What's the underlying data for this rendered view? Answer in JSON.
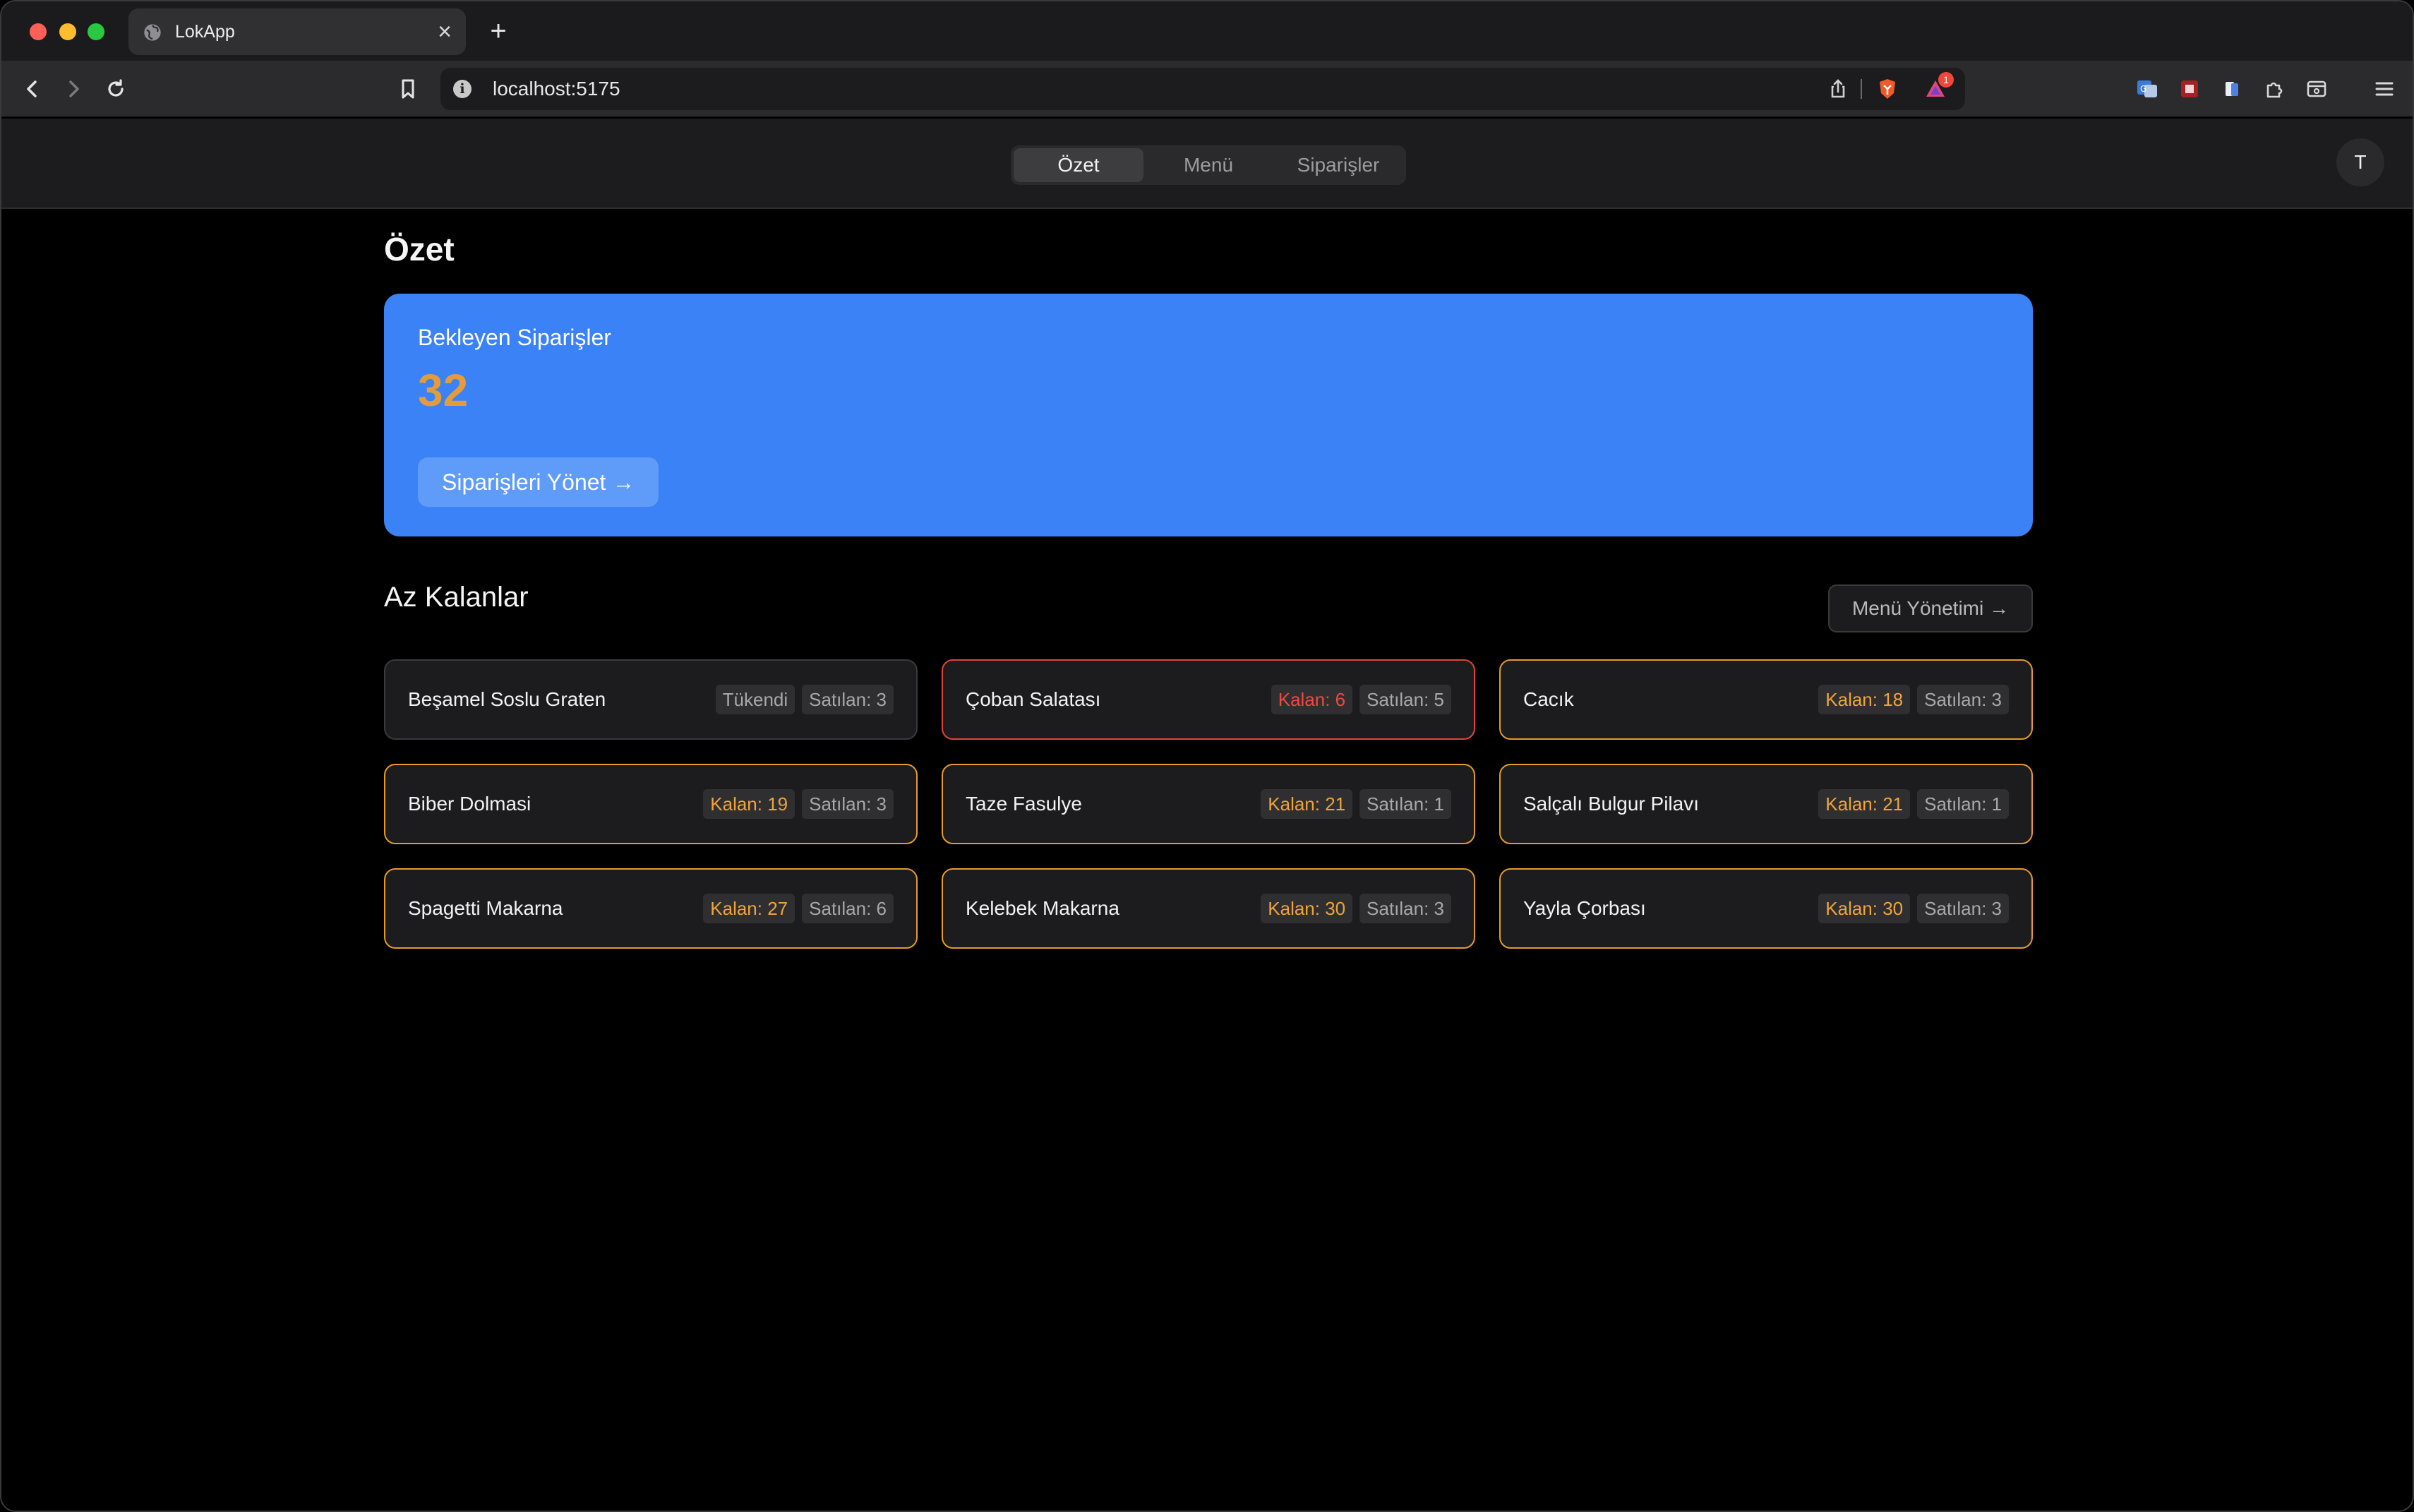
{
  "browser": {
    "tab_title": "LokApp",
    "url": "localhost:5175",
    "extension_badge": "1"
  },
  "nav": {
    "tabs": [
      {
        "label": "Özet",
        "active": true
      },
      {
        "label": "Menü",
        "active": false
      },
      {
        "label": "Siparişler",
        "active": false
      }
    ],
    "avatar_initial": "T"
  },
  "page": {
    "title": "Özet"
  },
  "pending": {
    "label": "Bekleyen Siparişler",
    "count": "32",
    "button": "Siparişleri Yönet →"
  },
  "low_stock": {
    "title": "Az Kalanlar",
    "button": "Menü Yönetimi →",
    "items": [
      {
        "name": "Beşamel Soslu Graten",
        "stock": "Tükendi",
        "sold": "Satılan: 3",
        "level": "out"
      },
      {
        "name": "Çoban Salatası",
        "stock": "Kalan: 6",
        "sold": "Satılan: 5",
        "level": "critical"
      },
      {
        "name": "Cacık",
        "stock": "Kalan: 18",
        "sold": "Satılan: 3",
        "level": "low"
      },
      {
        "name": "Biber Dolmasi",
        "stock": "Kalan: 19",
        "sold": "Satılan: 3",
        "level": "low"
      },
      {
        "name": "Taze Fasulye",
        "stock": "Kalan: 21",
        "sold": "Satılan: 1",
        "level": "low"
      },
      {
        "name": "Salçalı Bulgur Pilavı",
        "stock": "Kalan: 21",
        "sold": "Satılan: 1",
        "level": "low"
      },
      {
        "name": "Spagetti Makarna",
        "stock": "Kalan: 27",
        "sold": "Satılan: 6",
        "level": "low"
      },
      {
        "name": "Kelebek Makarna",
        "stock": "Kalan: 30",
        "sold": "Satılan: 3",
        "level": "low"
      },
      {
        "name": "Yayla Çorbası",
        "stock": "Kalan: 30",
        "sold": "Satılan: 3",
        "level": "low"
      }
    ]
  },
  "colors": {
    "accent_blue": "#3b82f6",
    "warning_amber": "#e69a2e",
    "danger_red": "#e0443a"
  }
}
